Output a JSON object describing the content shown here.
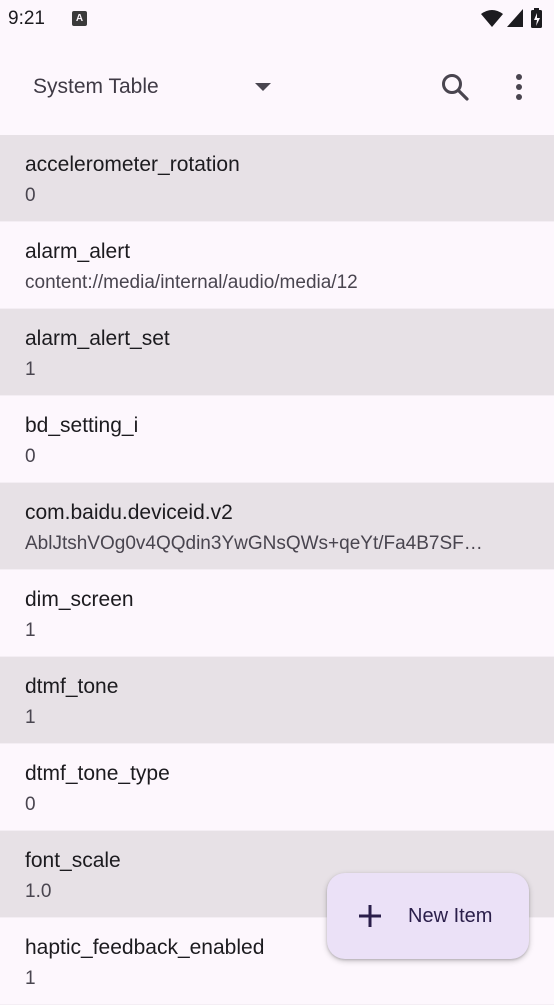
{
  "status": {
    "time": "9:21",
    "icons": [
      "notification-a-icon",
      "wifi-icon",
      "signal-icon",
      "battery-icon"
    ]
  },
  "toolbar": {
    "table_select_value": "System Table",
    "icons": [
      "dropdown-arrow-icon",
      "search-icon",
      "more-vert-icon"
    ]
  },
  "items": [
    {
      "name": "accelerometer_rotation",
      "value": "0"
    },
    {
      "name": "alarm_alert",
      "value": "content://media/internal/audio/media/12"
    },
    {
      "name": "alarm_alert_set",
      "value": "1"
    },
    {
      "name": "bd_setting_i",
      "value": "0"
    },
    {
      "name": "com.baidu.deviceid.v2",
      "value": "AblJtshVOg0v4QQdin3YwGNsQWs+qeYt/Fa4B7SF…"
    },
    {
      "name": "dim_screen",
      "value": "1"
    },
    {
      "name": "dtmf_tone",
      "value": "1"
    },
    {
      "name": "dtmf_tone_type",
      "value": "0"
    },
    {
      "name": "font_scale",
      "value": "1.0"
    },
    {
      "name": "haptic_feedback_enabled",
      "value": "1"
    }
  ],
  "fab": {
    "label": "New Item",
    "icon": "plus-icon"
  },
  "colors": {
    "background": "#fdf7fd",
    "shaded_row": "#e7e1e6",
    "fab_background": "#ebe1f7"
  }
}
